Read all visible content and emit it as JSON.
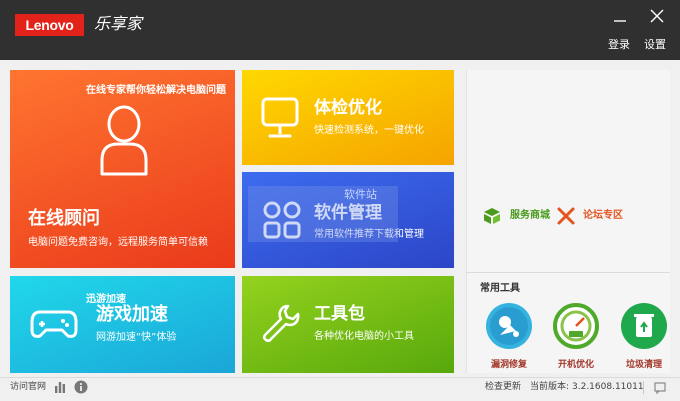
{
  "window": {
    "brand": "Lenovo",
    "app_name": "乐享家",
    "login": "登录",
    "settings": "设置"
  },
  "tiles": {
    "consult": {
      "tagline": "在线专家帮你轻松解决电脑问题",
      "title": "在线顾问",
      "subtitle": "电脑问题免费咨询，远程服务简单可信赖"
    },
    "check": {
      "title": "体检优化",
      "subtitle": "快速检测系统，一键优化"
    },
    "software": {
      "title": "软件管理",
      "subtitle": "常用软件推荐下载和管理"
    },
    "game": {
      "badge": "迅游加速",
      "title": "游戏加速",
      "subtitle": "网游加速“快”体验"
    },
    "tools": {
      "title": "工具包",
      "subtitle": "各种优化电脑的小工具"
    }
  },
  "watermark": {
    "text": "软件站"
  },
  "services": {
    "mall": "服务商城",
    "forum": "论坛专区"
  },
  "common_tools": {
    "title": "常用工具",
    "items": [
      {
        "label": "漏洞修复"
      },
      {
        "label": "开机优化"
      },
      {
        "label": "垃圾清理"
      }
    ]
  },
  "statusbar": {
    "visit": "访问官网",
    "check_update": "检查更新",
    "version_label": "当前版本:",
    "version": "3.2.1608.11011"
  },
  "colors": {
    "titlebar": "#303030",
    "brand_red": "#e2231a",
    "tile_consult": "#f0552a",
    "tile_check": "#f9c100",
    "tile_software": "#3558de",
    "tile_game": "#1fc2e3",
    "tile_tools": "#76bd16"
  }
}
